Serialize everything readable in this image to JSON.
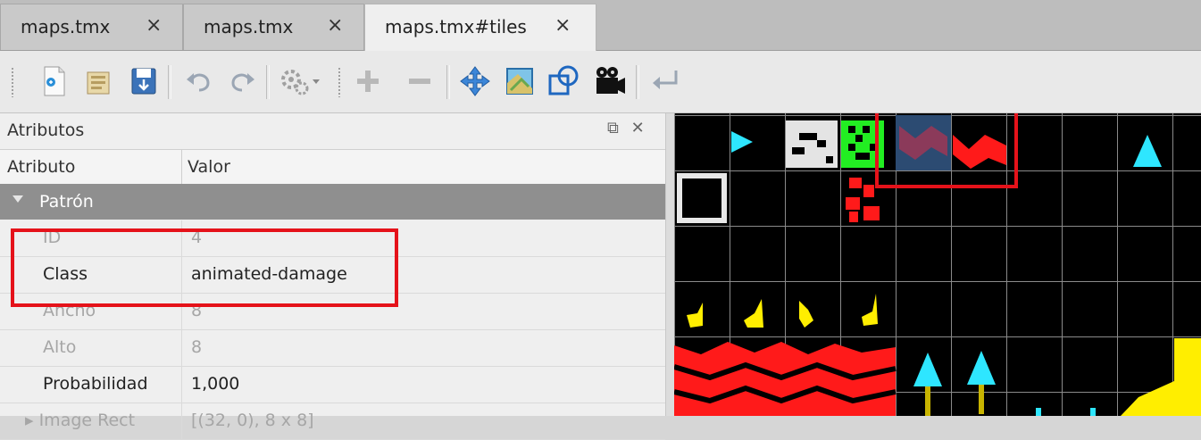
{
  "tabs": [
    {
      "label": "maps.tmx",
      "close": "×"
    },
    {
      "label": "maps.tmx",
      "close": "×"
    },
    {
      "label": "maps.tmx#tiles",
      "close": "×"
    }
  ],
  "toolbar": {
    "icons": [
      "new-file-icon",
      "open-folder-icon",
      "save-icon",
      "undo-icon",
      "redo-icon",
      "settings-dropdown-icon",
      "add-icon",
      "remove-icon",
      "move-icon",
      "map-icon",
      "shape-icon",
      "camera-icon",
      "return-icon"
    ]
  },
  "properties_panel": {
    "title": "Atributos",
    "header_attribute": "Atributo",
    "header_value": "Valor",
    "group": "Patrón",
    "rows": [
      {
        "key": "ID",
        "value": "4",
        "editable": false
      },
      {
        "key": "Class",
        "value": "animated-damage",
        "editable": true
      },
      {
        "key": "Ancho",
        "value": "8",
        "editable": false
      },
      {
        "key": "Alto",
        "value": "8",
        "editable": false
      },
      {
        "key": "Probabilidad",
        "value": "1,000",
        "editable": true
      },
      {
        "key": "Image Rect",
        "value": "[(32, 0), 8 x 8]",
        "editable": false
      }
    ],
    "buttons": {
      "float": "⧉",
      "close": "✕"
    }
  },
  "colors": {
    "highlight": "#e5121a",
    "tile_cyan": "#2ee6ff",
    "tile_red": "#ff1a1a",
    "tile_yellow": "#ffee00",
    "tile_green": "#22ee22"
  }
}
